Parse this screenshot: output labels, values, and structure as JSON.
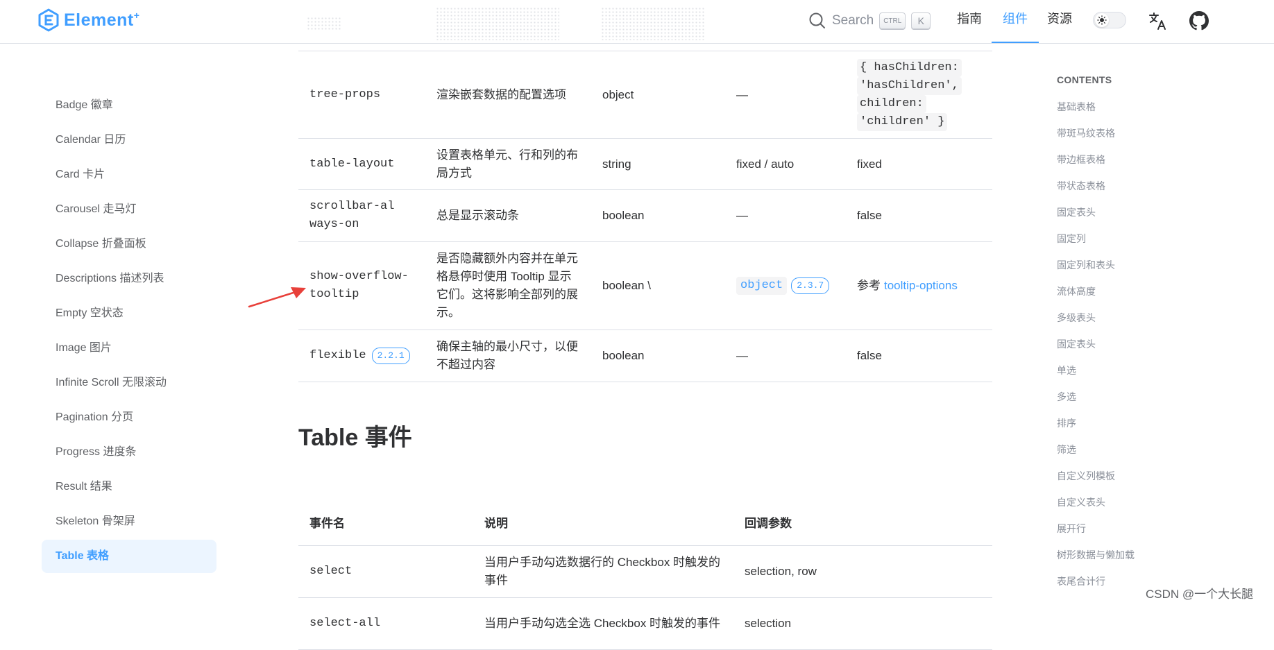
{
  "header": {
    "logo_text": "Element",
    "logo_plus": "+",
    "search_label": "Search",
    "kbd_ctrl": "CTRL",
    "kbd_k": "K",
    "nav": [
      {
        "label": "指南",
        "active": false
      },
      {
        "label": "组件",
        "active": true
      },
      {
        "label": "资源",
        "active": false
      }
    ],
    "icons": [
      "search-icon",
      "sun-icon",
      "translate-icon",
      "github-icon"
    ],
    "accent_color": "#409eff"
  },
  "sidebar": {
    "items": [
      {
        "label": "Badge 徽章",
        "active": false
      },
      {
        "label": "Calendar 日历",
        "active": false
      },
      {
        "label": "Card 卡片",
        "active": false
      },
      {
        "label": "Carousel 走马灯",
        "active": false
      },
      {
        "label": "Collapse 折叠面板",
        "active": false
      },
      {
        "label": "Descriptions 描述列表",
        "active": false
      },
      {
        "label": "Empty 空状态",
        "active": false
      },
      {
        "label": "Image 图片",
        "active": false
      },
      {
        "label": "Infinite Scroll 无限滚动",
        "active": false
      },
      {
        "label": "Pagination 分页",
        "active": false
      },
      {
        "label": "Progress 进度条",
        "active": false
      },
      {
        "label": "Result 结果",
        "active": false
      },
      {
        "label": "Skeleton 骨架屏",
        "active": false
      },
      {
        "label": "Table 表格",
        "active": true
      }
    ]
  },
  "attributes_table": {
    "rows": [
      {
        "name": "tree-props",
        "desc": "渲染嵌套数据的配置选项",
        "type": "object",
        "accepted": "—",
        "default_lines": [
          "{ hasChildren:",
          "'hasChildren',",
          "children:",
          "'children' }"
        ]
      },
      {
        "name": "table-layout",
        "desc": "设置表格单元、行和列的布局方式",
        "type": "string",
        "accepted": "fixed / auto",
        "default": "fixed"
      },
      {
        "name": "scrollbar-always-on",
        "desc": "总是显示滚动条",
        "type": "boolean",
        "accepted": "—",
        "default": "false"
      },
      {
        "name": "show-overflow-tooltip",
        "desc": "是否隐藏额外内容并在单元格悬停时使用 Tooltip 显示它们。这将影响全部列的展示。",
        "type": "boolean \\",
        "accepted_code": "object",
        "accepted_version": "2.3.7",
        "default_prefix": "参考",
        "default_link": "tooltip-options"
      },
      {
        "name": "flexible",
        "name_version": "2.2.1",
        "desc": "确保主轴的最小尺寸，以便不超过内容",
        "type": "boolean",
        "accepted": "—",
        "default": "false"
      }
    ]
  },
  "events_section": {
    "title": "Table 事件",
    "headers": [
      "事件名",
      "说明",
      "回调参数"
    ],
    "rows": [
      {
        "name": "select",
        "desc": "当用户手动勾选数据行的 Checkbox 时触发的事件",
        "params": "selection, row"
      },
      {
        "name": "select-all",
        "desc": "当用户手动勾选全选 Checkbox 时触发的事件",
        "params": "selection"
      }
    ]
  },
  "toc": {
    "title": "CONTENTS",
    "items": [
      "基础表格",
      "带斑马纹表格",
      "带边框表格",
      "带状态表格",
      "固定表头",
      "固定列",
      "固定列和表头",
      "流体高度",
      "多级表头",
      "固定表头",
      "单选",
      "多选",
      "排序",
      "筛选",
      "自定义列模板",
      "自定义表头",
      "展开行",
      "树形数据与懒加载",
      "表尾合计行"
    ]
  },
  "annotation": {
    "arrow_color": "#e8403a"
  },
  "watermark": "CSDN @一个大长腿"
}
